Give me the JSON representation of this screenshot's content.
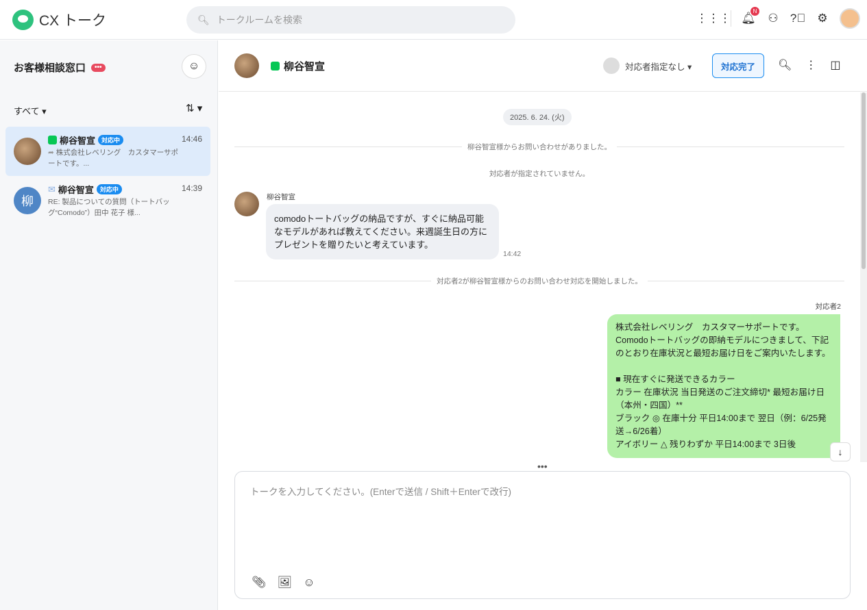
{
  "app": {
    "title": "CX トーク"
  },
  "search": {
    "placeholder": "トークルームを検索"
  },
  "topbar": {
    "notification_badge": "N"
  },
  "sidebar": {
    "title": "お客様相談窓口",
    "title_badge": "•••",
    "filter": "すべて ▾",
    "sort": "⇅ ▾",
    "conversations": [
      {
        "name": "柳谷智宣",
        "status": "対応中",
        "time": "14:46",
        "preview": "株式会社レベリング　カスタマーサポートです。...",
        "channel": "line"
      },
      {
        "name": "柳谷智宣",
        "status": "対応中",
        "time": "14:39",
        "preview": "RE: 製品についての質問（トートバッグ“Comodo”）田中 花子 様...",
        "channel": "mail",
        "avatar_text": "柳"
      }
    ]
  },
  "chat": {
    "name": "柳谷智宣",
    "assignee": "対応者指定なし ▾",
    "complete_button": "対応完了",
    "date": "2025. 6. 24. (火)",
    "sys1": "柳谷智宣様からお問い合わせがありました。",
    "sys2": "対応者が指定されていません。",
    "sys3": "対応者2が柳谷智宣様からのお問い合わせ対応を開始しました。",
    "incoming": {
      "sender": "柳谷智宣",
      "text": "comodoトートバッグの納品ですが、すぐに納品可能なモデルがあれば教えてください。来週誕生日の方にプレゼントを贈りたいと考えています。",
      "time": "14:42"
    },
    "outgoing": {
      "sender": "対応者2",
      "text": "株式会社レベリング　カスタマーサポートです。\nComodoトートバッグの即納モデルにつきまして、下記のとおり在庫状況と最短お届け日をご案内いたします。\n\n■ 現在すぐに発送できるカラー\nカラー 在庫状況 当日発送のご注文締切* 最短お届け日（本州・四国）**\nブラック ◎ 在庫十分 平日14:00まで 翌日（例：6/25発送→6/26着）\nアイボリー △ 残りわずか 平日14:00まで 3日後"
    }
  },
  "composer": {
    "placeholder": "トークを入力してください。(Enterで送信 / Shift＋Enterで改行)"
  }
}
